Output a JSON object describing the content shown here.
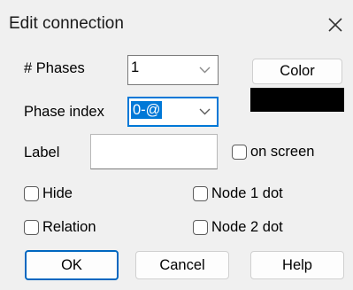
{
  "window": {
    "title": "Edit connection",
    "close_icon": "close-icon"
  },
  "phases": {
    "label": "# Phases",
    "value": "1"
  },
  "phase_index": {
    "label": "Phase index",
    "value": "0-@"
  },
  "color": {
    "button_label": "Color",
    "swatch_color": "#000000"
  },
  "label_field": {
    "label": "Label",
    "value": ""
  },
  "checkboxes": {
    "on_screen": "on screen",
    "hide": "Hide",
    "relation": "Relation",
    "node1_dot": "Node 1 dot",
    "node2_dot": "Node 2 dot"
  },
  "buttons": {
    "ok": "OK",
    "cancel": "Cancel",
    "help": "Help"
  },
  "colors": {
    "accent": "#0078d7",
    "dialog_bg": "#f0f0f0"
  }
}
